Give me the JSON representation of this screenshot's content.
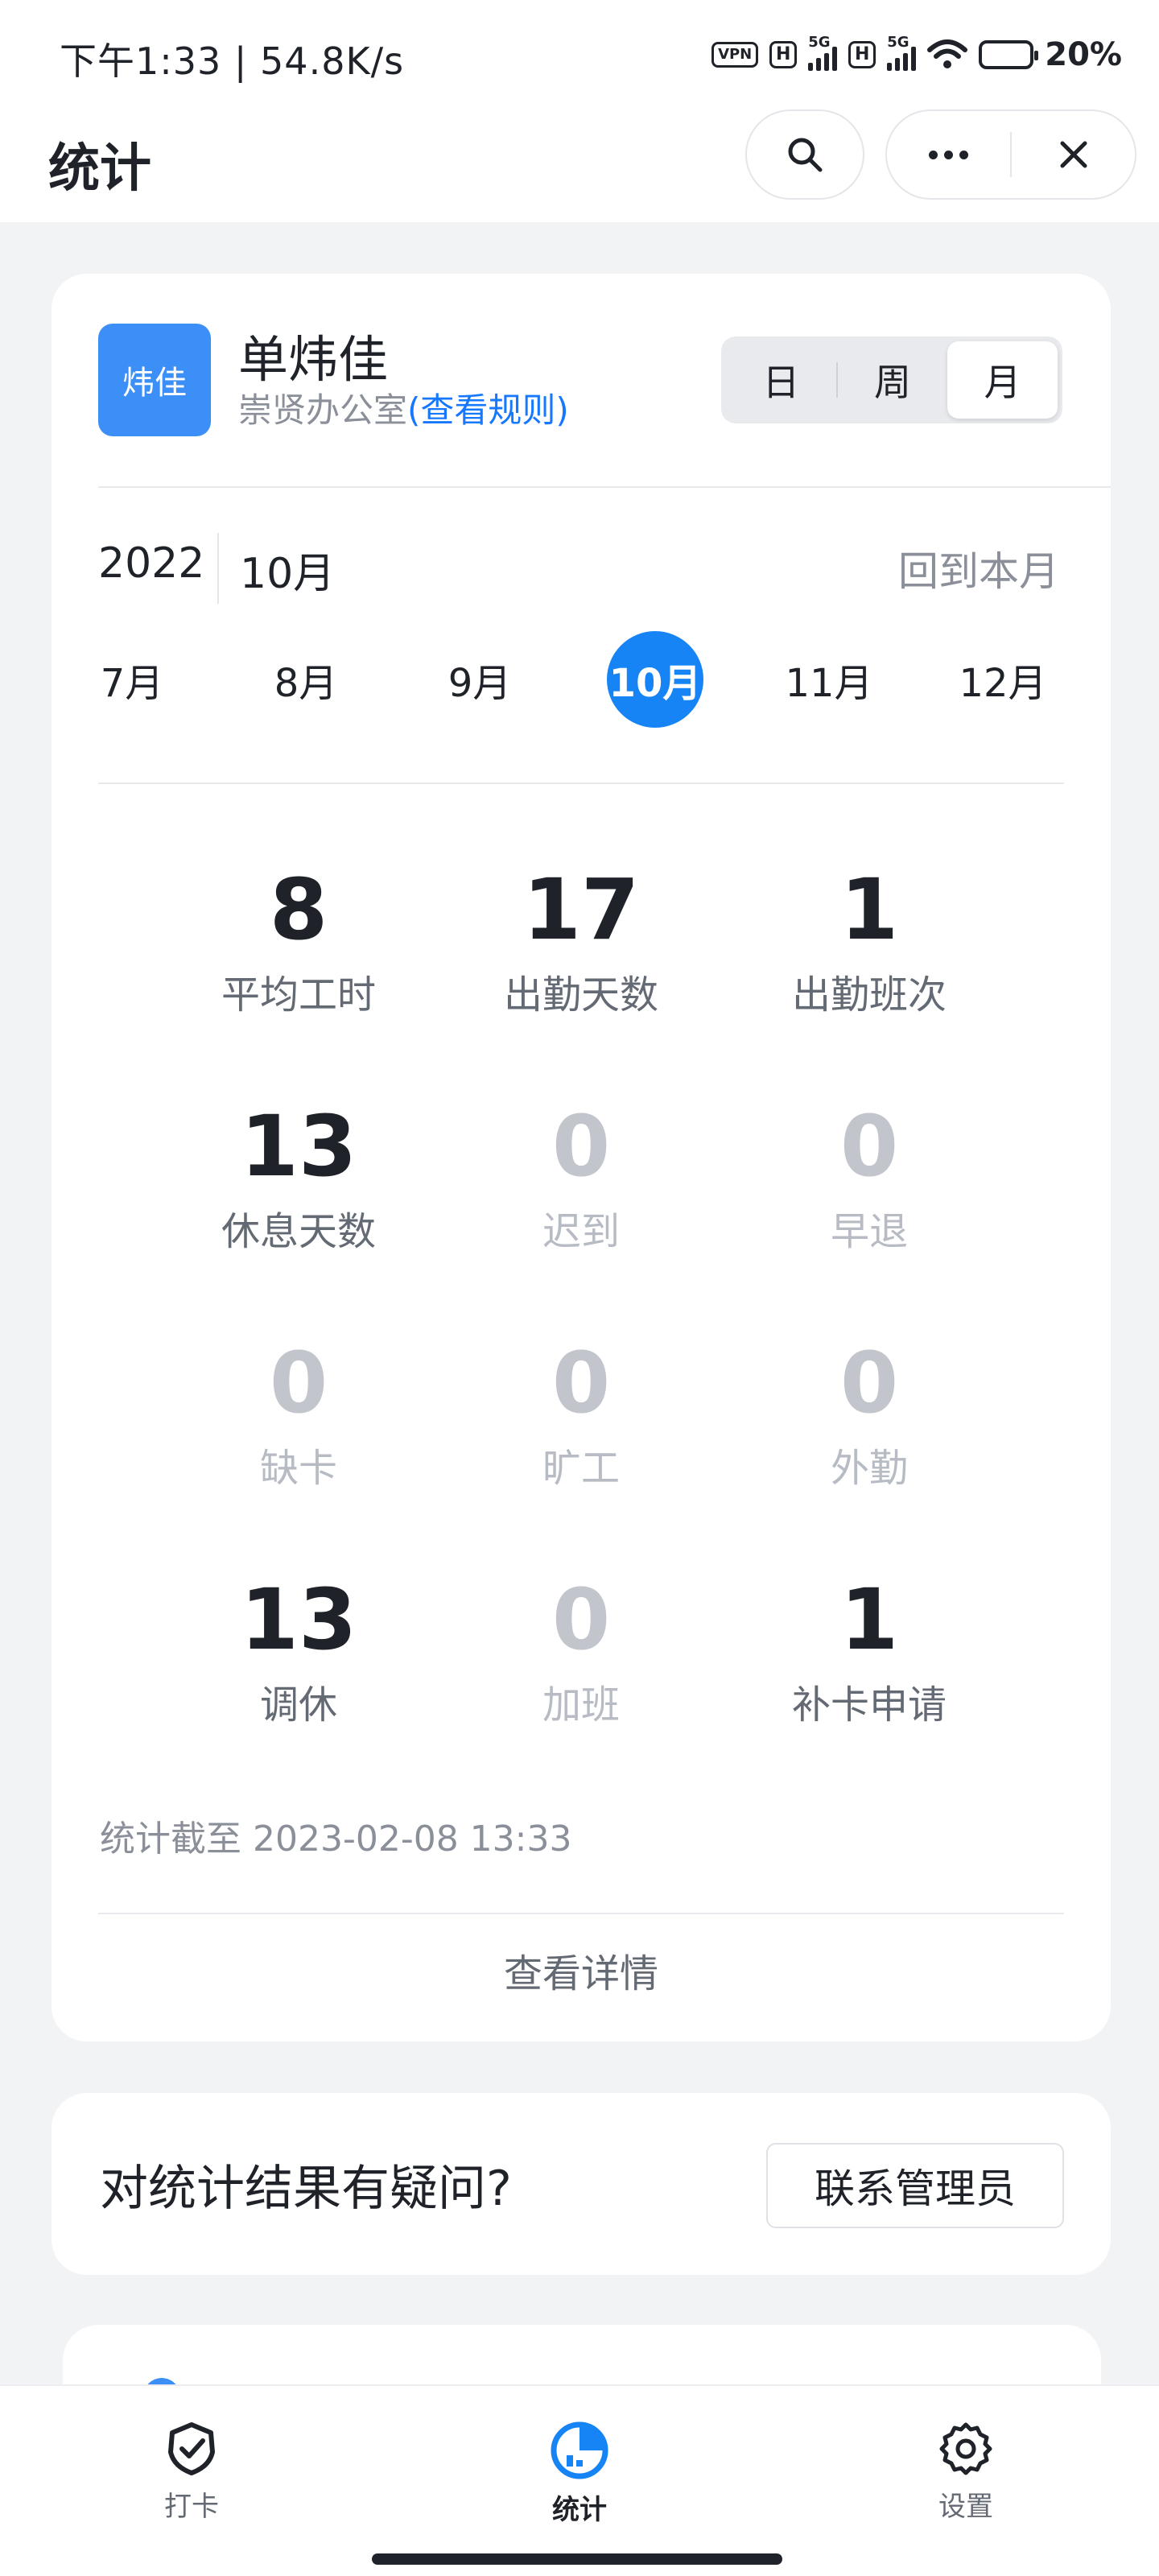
{
  "status_bar": {
    "time_speed": "下午1:33 | 54.8K/s",
    "vpn": "VPN",
    "hd1": "H",
    "gen1": "5G",
    "hd2": "H",
    "gen2": "5G",
    "battery": "20%"
  },
  "header": {
    "title": "统计"
  },
  "user": {
    "avatar_text": "炜佳",
    "name": "单炜佳",
    "office": "崇贤办公室",
    "rule_link": "(查看规则)"
  },
  "range_tabs": [
    {
      "label": "日"
    },
    {
      "label": "周"
    },
    {
      "label": "月",
      "active": true
    }
  ],
  "period": {
    "year": "2022",
    "month": "10月",
    "back_label": "回到本月"
  },
  "months": [
    {
      "label": "7月"
    },
    {
      "label": "8月"
    },
    {
      "label": "9月"
    },
    {
      "label": "10月",
      "active": true
    },
    {
      "label": "11月"
    },
    {
      "label": "12月"
    }
  ],
  "stats": [
    {
      "value": "8",
      "label": "平均工时",
      "muted": false
    },
    {
      "value": "17",
      "label": "出勤天数",
      "muted": false
    },
    {
      "value": "1",
      "label": "出勤班次",
      "muted": false
    },
    {
      "value": "13",
      "label": "休息天数",
      "muted": false
    },
    {
      "value": "0",
      "label": "迟到",
      "muted": true
    },
    {
      "value": "0",
      "label": "早退",
      "muted": true
    },
    {
      "value": "0",
      "label": "缺卡",
      "muted": true
    },
    {
      "value": "0",
      "label": "旷工",
      "muted": true
    },
    {
      "value": "0",
      "label": "外勤",
      "muted": true
    },
    {
      "value": "13",
      "label": "调休",
      "muted": false
    },
    {
      "value": "0",
      "label": "加班",
      "muted": true
    },
    {
      "value": "1",
      "label": "补卡申请",
      "muted": false
    }
  ],
  "as_of": "统计截至 2023-02-08 13:33",
  "detail_link": "查看详情",
  "question": {
    "text": "对统计结果有疑问?",
    "button": "联系管理员"
  },
  "nav": [
    {
      "label": "打卡",
      "icon": "check-badge-icon"
    },
    {
      "label": "统计",
      "icon": "stats-chart-icon",
      "active": true
    },
    {
      "label": "设置",
      "icon": "gear-icon"
    }
  ],
  "colors": {
    "accent": "#1784f5",
    "avatar": "#3b8ff6",
    "link": "#1677ff",
    "battery_low": "#f5222d"
  }
}
